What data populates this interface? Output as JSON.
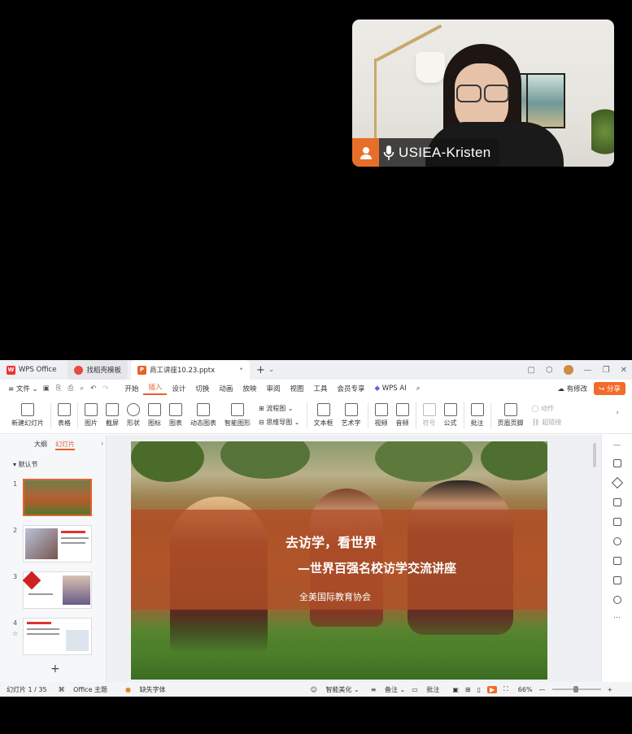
{
  "video": {
    "participant_name": "USIEA-Kristen"
  },
  "tabs": [
    {
      "label": "WPS Office"
    },
    {
      "label": "找稻壳模板"
    },
    {
      "label": "商工讲座10.23.pptx"
    }
  ],
  "menu": {
    "file": "文件",
    "items": [
      "开始",
      "插入",
      "设计",
      "切换",
      "动画",
      "放映",
      "审阅",
      "视图",
      "工具",
      "会员专享"
    ],
    "ai": "WPS AI",
    "right": {
      "revise": "有修改",
      "share": "分享"
    }
  },
  "ribbon": {
    "new_slide": "新建幻灯片",
    "table": "表格",
    "picture": "图片",
    "screenshot": "截屏",
    "shape": "形状",
    "icon": "图标",
    "chart": "图表",
    "dynamic_chart": "动态图表",
    "smart_graphic": "智能图形",
    "flowchart": "流程图",
    "mindmap": "思维导图",
    "textbox": "文本框",
    "wordart": "艺术字",
    "video": "视频",
    "audio": "音频",
    "symbol": "符号",
    "formula": "公式",
    "comment": "批注",
    "header_footer": "页眉页脚",
    "action": "动作",
    "hyperlink": "超链接"
  },
  "thumbs": {
    "tab_outline": "大纲",
    "tab_slides": "幻灯片",
    "section": "默认节",
    "numbers": [
      "1",
      "2",
      "3",
      "4"
    ]
  },
  "slide": {
    "title": "去访学，看世界",
    "subtitle": "—世界百强名校访学交流讲座",
    "org": "全美国际教育协会"
  },
  "status": {
    "slide_count": "幻灯片 1 / 35",
    "theme": "Office 主题",
    "missing_font": "缺失字体",
    "beautify": "智能美化",
    "notes": "备注",
    "comments": "批注",
    "zoom": "66%"
  }
}
